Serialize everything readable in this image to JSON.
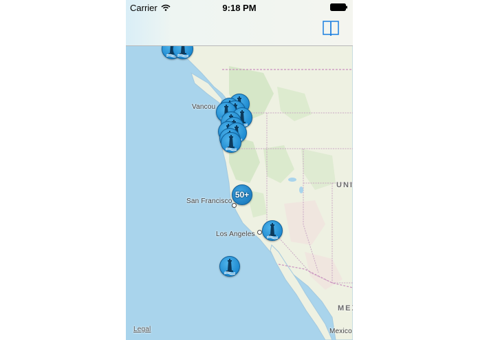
{
  "status": {
    "carrier": "Carrier",
    "time": "9:18 PM"
  },
  "nav": {
    "bookmarks_icon": "book-icon"
  },
  "map": {
    "labels": {
      "vancouver": "Vancou",
      "san_francisco": "San Francisco",
      "los_angeles": "Los Angeles",
      "country_us": "UNI",
      "country_mexico": "MEX",
      "mexicali": "Mexico",
      "legal": "Legal"
    },
    "cluster_count": "50+"
  },
  "colors": {
    "ocean": "#a9d4ec",
    "land": "#eef1e2",
    "pin": "#1f8bd1"
  }
}
